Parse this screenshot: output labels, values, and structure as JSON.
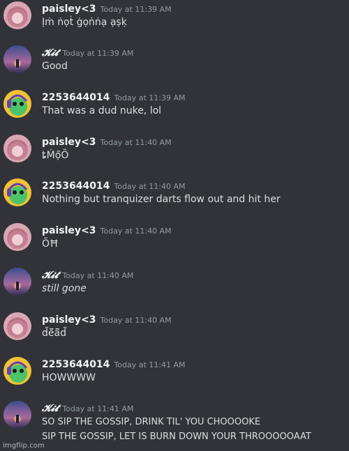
{
  "messages": [
    {
      "author": "paisley<3",
      "timestamp": "Today at 11:39 AM",
      "text": "Ịṁ ṅọṫ ġọṅṅạ ạṣḳ",
      "avatar": "pink-hair-avatar"
    },
    {
      "author": "𝓚𝓲𝓽",
      "timestamp": "Today at 11:39 AM",
      "text": "Good",
      "avatar": "sunset-avatar"
    },
    {
      "author": "2253644014",
      "timestamp": "Today at 11:39 AM",
      "text": "That was a dud nuke, lol",
      "avatar": "green-frog-headphones-avatar"
    },
    {
      "author": "paisley<3",
      "timestamp": "Today at 11:40 AM",
      "text": "ȶḾọ̃Õ",
      "avatar": "pink-hair-avatar"
    },
    {
      "author": "2253644014",
      "timestamp": "Today at 11:40 AM",
      "text": "Nothing but tranquizer darts flow out and hit her",
      "avatar": "green-frog-headphones-avatar"
    },
    {
      "author": "paisley<3",
      "timestamp": "Today at 11:40 AM",
      "text": "ÕĦ",
      "avatar": "pink-hair-avatar"
    },
    {
      "author": "𝓚𝓲𝓽",
      "timestamp": "Today at 11:40 AM",
      "text": "still gone",
      "avatar": "sunset-avatar"
    },
    {
      "author": "paisley<3",
      "timestamp": "Today at 11:40 AM",
      "text": "d̃ë̃ä̃d̃",
      "avatar": "pink-hair-avatar"
    },
    {
      "author": "2253644014",
      "timestamp": "Today at 11:41 AM",
      "text": "HOWWWW",
      "avatar": "green-frog-headphones-avatar"
    },
    {
      "author": "𝓚𝓲𝓽",
      "timestamp": "Today at 11:41 AM",
      "text": "SO SIP THE GOSSIP, DRINK TIL' YOU CHOOOOKE",
      "text2": "SIP THE GOSSIP, LET IS BURN DOWN YOUR THROOOOOAAT",
      "avatar": "sunset-avatar"
    }
  ],
  "watermark": "imgflip.com",
  "colors": {
    "background": "#313338",
    "author": "#f2f3f5",
    "timestamp": "#949ba4",
    "message_text": "#dbdee1"
  }
}
